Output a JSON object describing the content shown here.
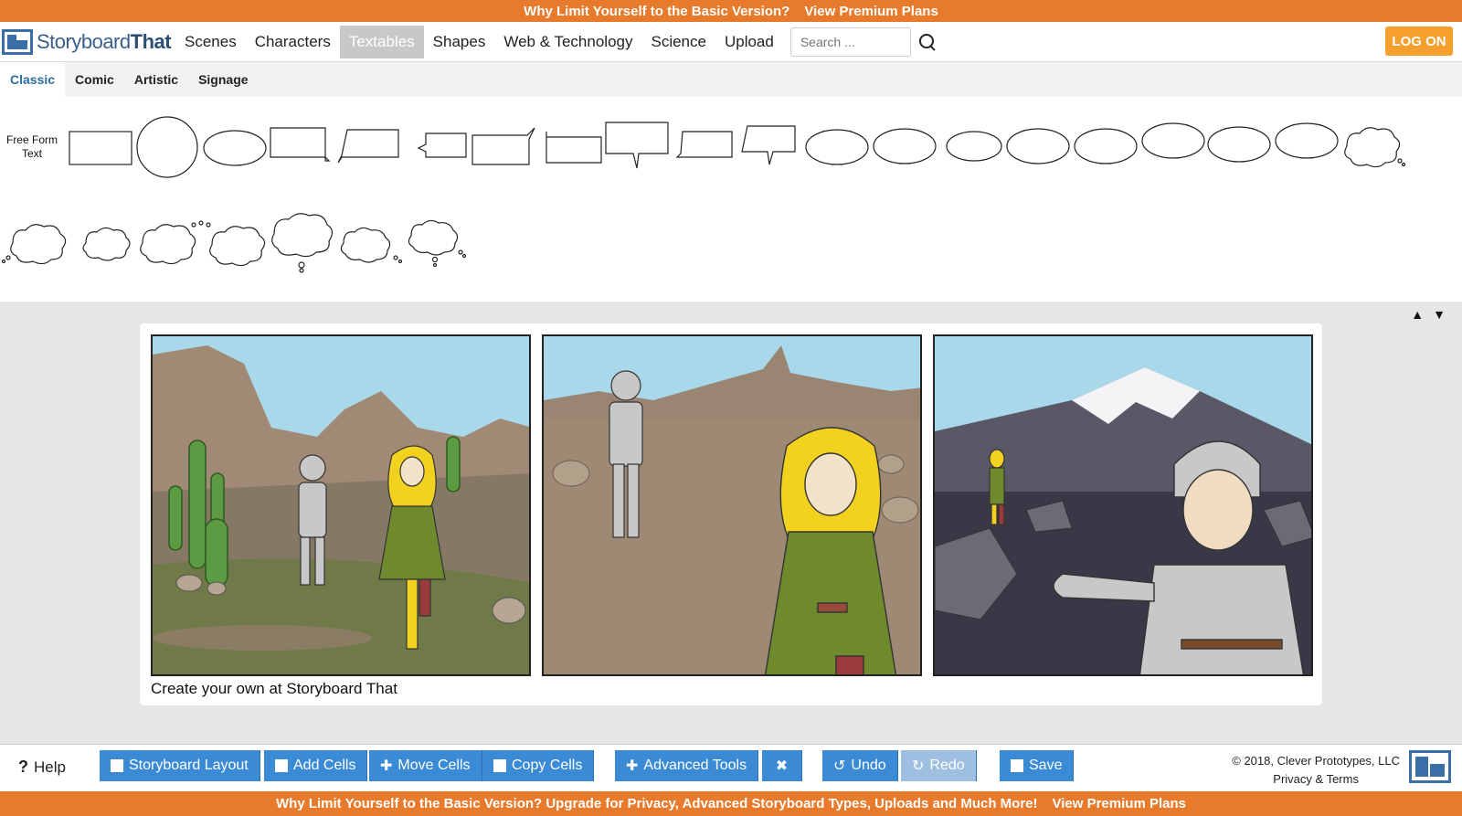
{
  "top_banner": {
    "text": "Why Limit Yourself to the Basic Version?",
    "link": "View Premium Plans"
  },
  "header": {
    "logo_text_1": "Storyboard",
    "logo_text_2": "That",
    "nav": [
      "Scenes",
      "Characters",
      "Textables",
      "Shapes",
      "Web & Technology",
      "Science",
      "Upload"
    ],
    "active_nav": "Textables",
    "search_placeholder": "Search ...",
    "login_label": "LOG ON"
  },
  "subtabs": {
    "items": [
      "Classic",
      "Comic",
      "Artistic",
      "Signage"
    ],
    "active": "Classic"
  },
  "palette": {
    "free_form_label_1": "Free Form",
    "free_form_label_2": "Text"
  },
  "storyboard": {
    "caption": "Create your own at Storyboard That",
    "cells": [
      "desert",
      "desert",
      "mountain"
    ]
  },
  "toolbar": {
    "help": "Help",
    "storyboard_layout": "Storyboard Layout",
    "add_cells": "Add Cells",
    "move_cells": "Move Cells",
    "copy_cells": "Copy Cells",
    "advanced_tools": "Advanced Tools",
    "undo": "Undo",
    "redo": "Redo",
    "save": "Save",
    "copyright": "© 2018, Clever Prototypes, LLC",
    "privacy": "Privacy & Terms"
  },
  "bottom_banner": {
    "text": "Why Limit Yourself to the Basic Version? Upgrade for Privacy, Advanced Storyboard Types, Uploads and Much More!",
    "link": "View Premium Plans"
  },
  "colors": {
    "orange": "#e87a2c",
    "button_blue": "#3b8ad6",
    "login_orange": "#f5a02c"
  }
}
